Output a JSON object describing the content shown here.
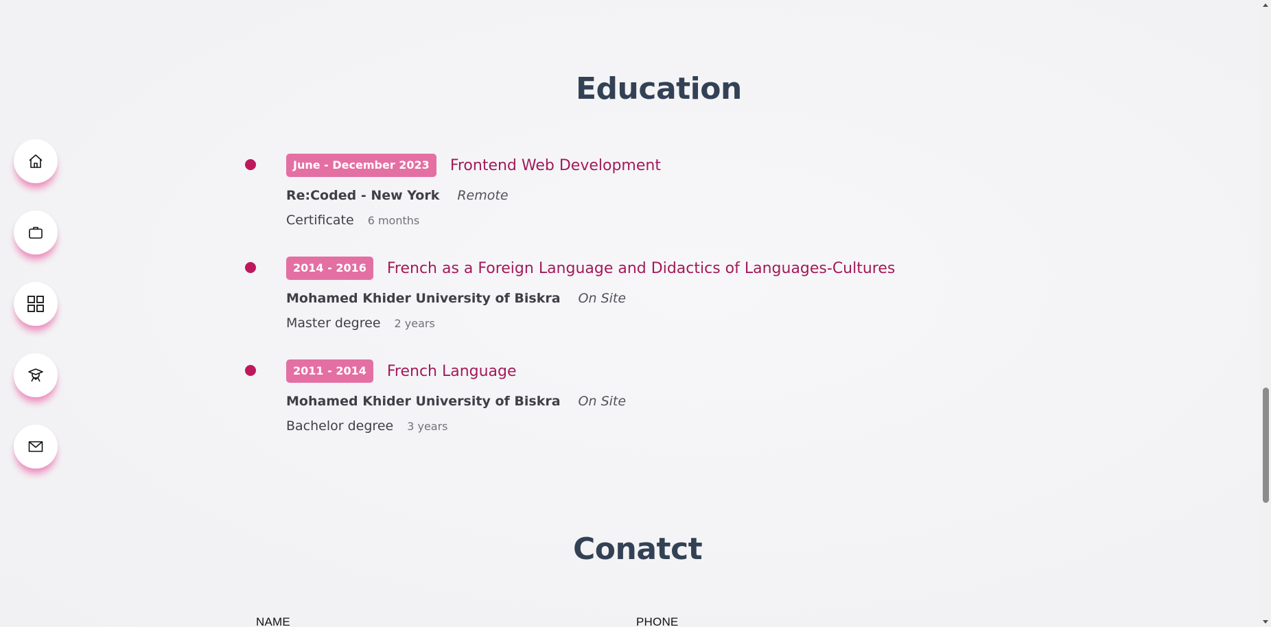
{
  "nav": {
    "items": [
      {
        "icon": "home-icon"
      },
      {
        "icon": "briefcase-icon"
      },
      {
        "icon": "grid-icon"
      },
      {
        "icon": "graduate-icon"
      },
      {
        "icon": "mail-icon"
      }
    ]
  },
  "education": {
    "title": "Education",
    "items": [
      {
        "date": "June - December 2023",
        "title": "Frontend Web Development",
        "school": "Re:Coded - New York",
        "mode": "Remote",
        "level": "Certificate",
        "duration": "6 months"
      },
      {
        "date": "2014 - 2016",
        "title": "French as a Foreign Language and Didactics of Languages-Cultures",
        "school": "Mohamed Khider University of Biskra",
        "mode": "On Site",
        "level": "Master degree",
        "duration": "2 years"
      },
      {
        "date": "2011 - 2014",
        "title": "French Language",
        "school": "Mohamed Khider University of Biskra",
        "mode": "On Site",
        "level": "Bachelor degree",
        "duration": "3 years"
      }
    ]
  },
  "contact": {
    "title": "Conatct",
    "name_label": "NAME",
    "phone_label": "PHONE"
  },
  "colors": {
    "accent": "#be185d",
    "badge": "#e46fa3",
    "heading": "#334155"
  }
}
